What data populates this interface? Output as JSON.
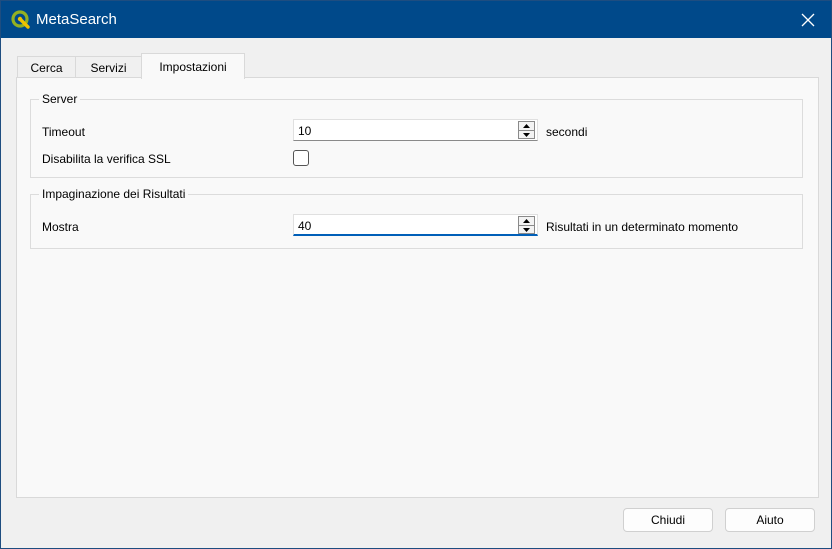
{
  "window": {
    "title": "MetaSearch",
    "accent": "#00498a"
  },
  "tabs": [
    {
      "label": "Cerca"
    },
    {
      "label": "Servizi"
    },
    {
      "label": "Impostazioni",
      "active": true
    }
  ],
  "server": {
    "title": "Server",
    "timeout_label": "Timeout",
    "timeout_value": "10",
    "timeout_suffix": "secondi",
    "ssl_label": "Disabilita la verifica SSL",
    "ssl_checked": false
  },
  "paging": {
    "title": "Impaginazione dei Risultati",
    "show_label": "Mostra",
    "show_value": "40",
    "show_suffix": "Risultati in un determinato momento"
  },
  "footer": {
    "close_label": "Chiudi",
    "help_label": "Aiuto"
  }
}
